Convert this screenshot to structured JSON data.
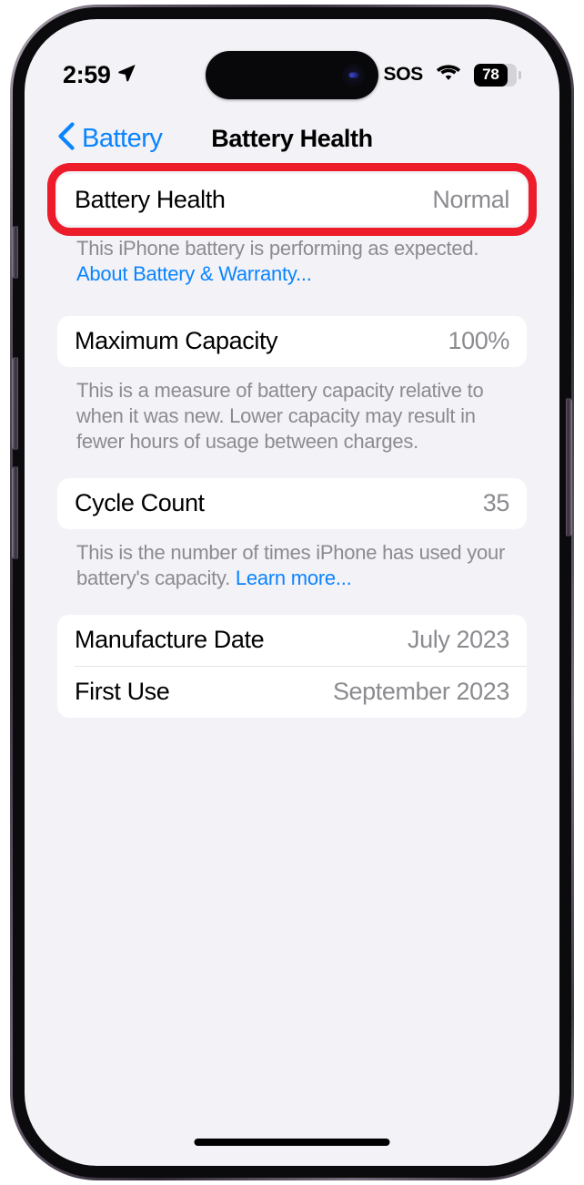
{
  "status_bar": {
    "time": "2:59",
    "location_icon": "location-arrow-icon",
    "sos_label": "SOS",
    "wifi_icon": "wifi-icon",
    "battery_percent": "78",
    "battery_level": 78
  },
  "nav": {
    "back_label": "Battery",
    "back_icon": "chevron-left-icon",
    "title": "Battery Health"
  },
  "groups": [
    {
      "rows": [
        {
          "label": "Battery Health",
          "value": "Normal"
        }
      ],
      "footer": {
        "text": "This iPhone battery is performing as expected. ",
        "link": "About Battery & Warranty..."
      }
    },
    {
      "rows": [
        {
          "label": "Maximum Capacity",
          "value": "100%"
        }
      ],
      "footer": {
        "text": "This is a measure of battery capacity relative to when it was new. Lower capacity may result in fewer hours of usage between charges.",
        "link": ""
      }
    },
    {
      "rows": [
        {
          "label": "Cycle Count",
          "value": "35"
        }
      ],
      "footer": {
        "text": "This is the number of times iPhone has used your battery's capacity. ",
        "link": "Learn more..."
      }
    },
    {
      "rows": [
        {
          "label": "Manufacture Date",
          "value": "July 2023"
        },
        {
          "label": "First Use",
          "value": "September 2023"
        }
      ],
      "footer": {
        "text": "",
        "link": ""
      }
    }
  ],
  "annotation": {
    "highlight_color": "#ed1c2b",
    "target": "Battery Health"
  },
  "colors": {
    "accent_blue": "#0a84ff",
    "background": "#f3f2f7",
    "card": "#ffffff",
    "secondary_text": "#8b8b90"
  }
}
